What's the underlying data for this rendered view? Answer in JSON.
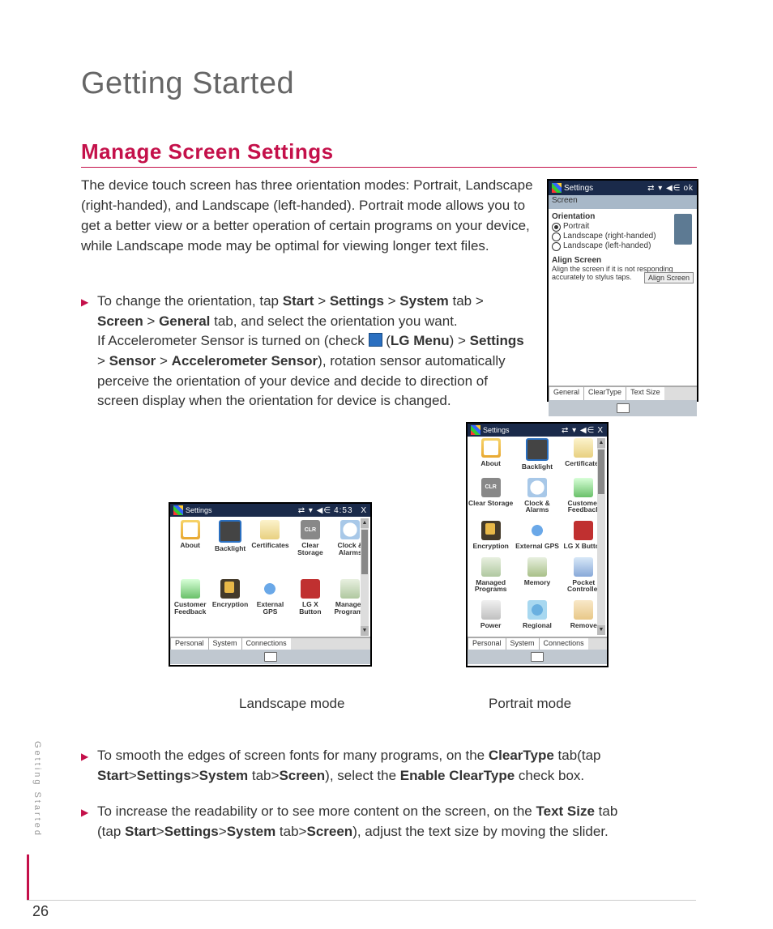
{
  "page_title": "Getting Started",
  "section_title": "Manage Screen Settings",
  "side_text": "Getting Started",
  "page_number": "26",
  "intro": "The device touch screen has three orientation modes: Portrait, Landscape (right-handed), and Landscape (left-handed). Portrait mode allows you to get a better view or a better operation of certain programs on your device, while Landscape mode may be optimal for viewing longer text files.",
  "bullet1": {
    "pre": "To change the orientation, tap ",
    "start": "Start",
    "settings": "Settings",
    "system": "System",
    "tab_gt": " tab > ",
    "screen": "Screen",
    "general": "General",
    "tab_and": " tab, and select the orientation you want.",
    "line3a": "If Accelerometer Sensor is turned on (check ",
    "lgmenu": "LG Menu",
    "line3b": ") > ",
    "settings2": "Settings",
    "line4a": "> ",
    "sensor": "Sensor",
    "acc": "Accelerometer Sensor",
    "line4b": "), rotation sensor automatically",
    "line5": "perceive the orientation of your device and decide to direction of",
    "line6": "screen display when the orientation for device  is changed."
  },
  "caption_landscape": "Landscape mode",
  "caption_portrait": "Portrait mode",
  "bullet2": {
    "a": "To smooth the edges of screen fonts for many programs, on the ",
    "ct": "ClearType",
    "b": " tab(tap ",
    "start": "Start",
    "settings": "Settings",
    "system": "System",
    "tab": " tab>",
    "screen": "Screen",
    "c": "), select the ",
    "enable": "Enable ClearType",
    "d": " check box."
  },
  "bullet3": {
    "a": "To increase the readability or to see more content on the screen, on the ",
    "ts": "Text Size",
    "b": " tab",
    "c": "(tap ",
    "start": "Start",
    "settings": "Settings",
    "system": "System",
    "tab": " tab>",
    "screen": "Screen",
    "d": "), adjust the text size by moving the slider."
  },
  "dev1": {
    "title": "Settings",
    "ok": "ok",
    "subtitle": "Screen",
    "orientation": "Orientation",
    "opt_portrait": "Portrait",
    "opt_land_r": "Landscape (right-handed)",
    "opt_land_l": "Landscape (left-handed)",
    "align_title": "Align Screen",
    "align_text": "Align the screen if it is not responding accurately to stylus taps.",
    "align_btn": "Align Screen",
    "tabs": [
      "General",
      "ClearType",
      "Text Size"
    ]
  },
  "dev2": {
    "title": "Settings",
    "close": "X",
    "items": [
      {
        "label": "About",
        "ico": "ico-about"
      },
      {
        "label": "Backlight",
        "ico": "ico-bl"
      },
      {
        "label": "Certificates",
        "ico": "ico-cert"
      },
      {
        "label": "Clear Storage",
        "ico": "ico-clr",
        "txt": "CLR"
      },
      {
        "label": "Clock & Alarms",
        "ico": "ico-clk"
      },
      {
        "label": "Customer Feedback",
        "ico": "ico-fb"
      },
      {
        "label": "Encryption",
        "ico": "ico-enc"
      },
      {
        "label": "External GPS",
        "ico": "ico-gps"
      },
      {
        "label": "LG X Button",
        "ico": "ico-lgx"
      },
      {
        "label": "Managed Programs",
        "ico": "ico-mp"
      },
      {
        "label": "Memory",
        "ico": "ico-mem"
      },
      {
        "label": "Pocket Controller",
        "ico": "ico-pc"
      },
      {
        "label": "Power",
        "ico": "ico-pw"
      },
      {
        "label": "Regional",
        "ico": "ico-reg"
      },
      {
        "label": "Remove",
        "ico": "ico-rm"
      }
    ],
    "tabs": [
      "Personal",
      "System",
      "Connections"
    ]
  },
  "dev3": {
    "title": "Settings",
    "time": "4:53",
    "close": "X",
    "items": [
      {
        "label": "About",
        "ico": "ico-about"
      },
      {
        "label": "Backlight",
        "ico": "ico-bl"
      },
      {
        "label": "Certificates",
        "ico": "ico-cert"
      },
      {
        "label": "Clear Storage",
        "ico": "ico-clr",
        "txt": "CLR"
      },
      {
        "label": "Clock & Alarms",
        "ico": "ico-clk"
      },
      {
        "label": "Customer Feedback",
        "ico": "ico-fb"
      },
      {
        "label": "Encryption",
        "ico": "ico-enc"
      },
      {
        "label": "External GPS",
        "ico": "ico-gps"
      },
      {
        "label": "LG X Button",
        "ico": "ico-lgx"
      },
      {
        "label": "Managed Programs",
        "ico": "ico-mp"
      }
    ],
    "tabs": [
      "Personal",
      "System",
      "Connections"
    ]
  },
  "gt": " > "
}
